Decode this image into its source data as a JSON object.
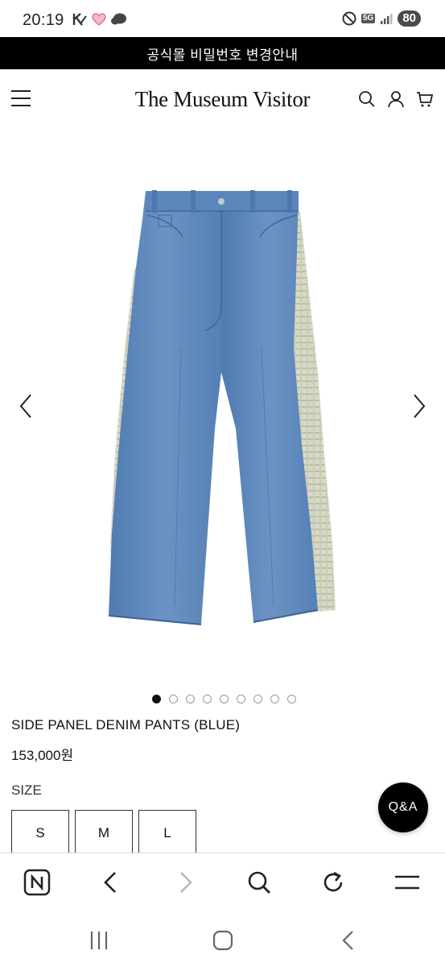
{
  "status_bar": {
    "time": "20:19",
    "left_icons": [
      "k-app-icon",
      "heart-icon",
      "chat-bubble-icon"
    ],
    "right_icons": [
      "do-not-disturb-icon",
      "5g-icon",
      "signal-icon"
    ],
    "network": "5G",
    "battery": "80"
  },
  "notice": {
    "text": "공식몰 비밀번호 변경안내"
  },
  "header": {
    "logo": "The Museum Visitor",
    "icons": [
      "menu-icon",
      "search-icon",
      "user-icon",
      "cart-icon"
    ]
  },
  "gallery": {
    "image_icon": "jeans-product-image",
    "prev_icon": "chevron-left-icon",
    "next_icon": "chevron-right-icon",
    "page_count": 9,
    "active_index": 0
  },
  "product": {
    "name": "SIDE PANEL DENIM PANTS (BLUE)",
    "price": "153,000원",
    "size_label": "SIZE",
    "sizes": [
      "S",
      "M",
      "L"
    ]
  },
  "qa_button": {
    "label": "Q&A"
  },
  "browser_bar": {
    "icons": [
      "naver-home-icon",
      "back-icon",
      "forward-icon",
      "search-icon",
      "reload-icon",
      "menu-icon"
    ]
  },
  "system_nav": {
    "icons": [
      "recent-apps-icon",
      "home-icon",
      "back-icon"
    ]
  },
  "colors": {
    "notice_bg": "#000000",
    "denim": "#5a84b8",
    "qa_bg": "#000000"
  }
}
